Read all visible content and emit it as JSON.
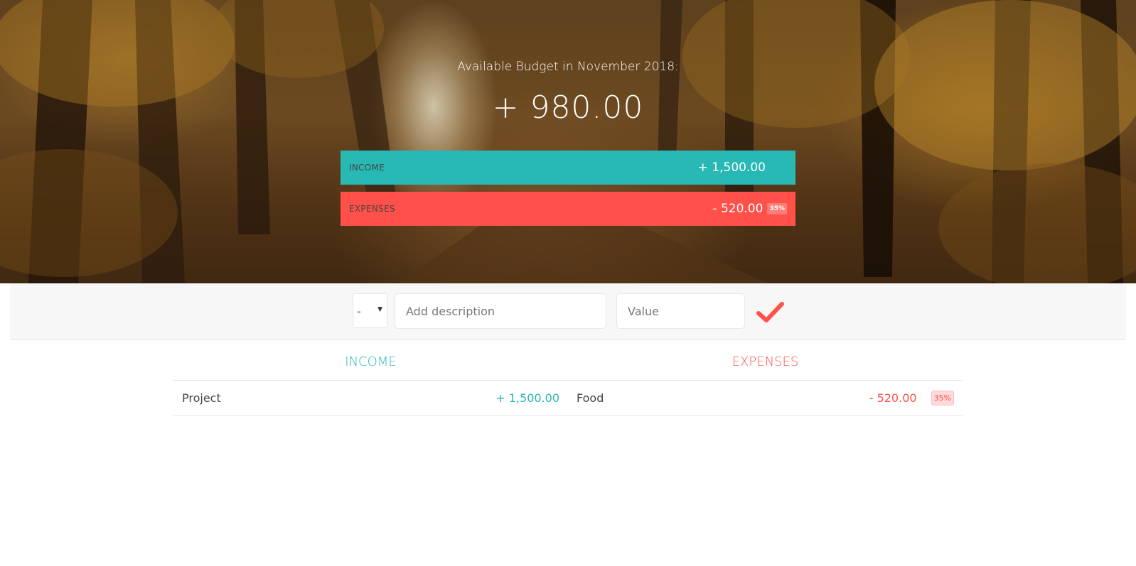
{
  "header": {
    "title": "Available Budget in November 2018:",
    "budget": "+ 980.00"
  },
  "summary": {
    "income": {
      "label": "Income",
      "value": "+ 1,500.00"
    },
    "expenses": {
      "label": "Expenses",
      "value": "- 520.00",
      "percentage": "35%"
    }
  },
  "add_form": {
    "type_selected": "-",
    "description_placeholder": "Add description",
    "value_placeholder": "Value",
    "submit_icon": "checkmark-icon"
  },
  "lists": {
    "income": {
      "title": "Income",
      "items": [
        {
          "description": "Project",
          "value": "+ 1,500.00"
        }
      ]
    },
    "expenses": {
      "title": "Expenses",
      "items": [
        {
          "description": "Food",
          "value": "- 520.00",
          "percentage": "35%"
        }
      ]
    }
  },
  "colors": {
    "income": "#28b9b5",
    "expenses": "#ff5049"
  }
}
